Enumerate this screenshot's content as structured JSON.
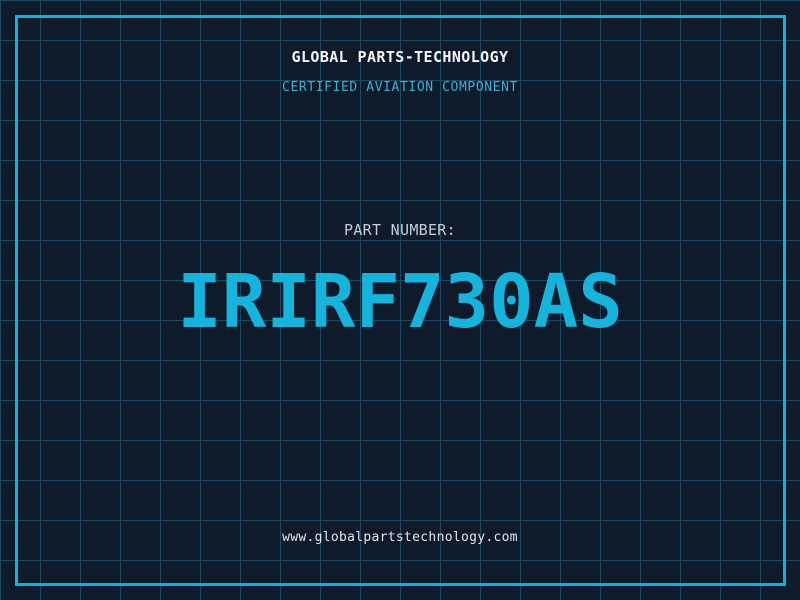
{
  "header": {
    "company": "GLOBAL PARTS-TECHNOLOGY",
    "tagline": "CERTIFIED AVIATION COMPONENT"
  },
  "part": {
    "label": "PART NUMBER:",
    "number": "IRIRF730AS"
  },
  "footer": {
    "website": "www.globalpartstechnology.com"
  },
  "colors": {
    "background": "#0f1a2b",
    "grid_line": "#1b4a63",
    "frame_border": "#0fb2d9",
    "company_text": "#f4f6f8",
    "tagline_text": "#3cb0d5",
    "part_label_text": "#c6cdd8",
    "part_number_text": "#15b4dc",
    "website_text": "#e2e7ed"
  }
}
